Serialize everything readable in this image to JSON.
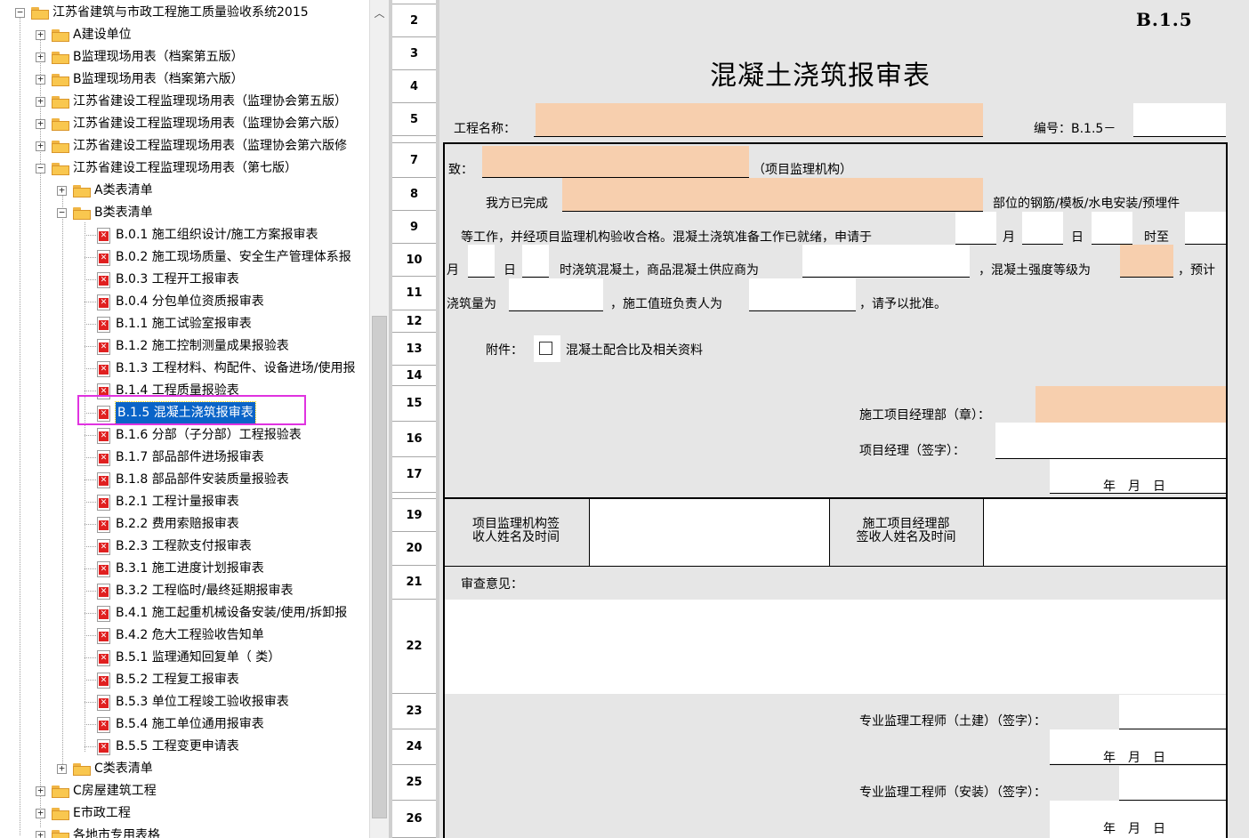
{
  "tree": {
    "root": "江苏省建筑与市政工程施工质量验收系统2015",
    "nodes": [
      "A建设单位",
      "B监理现场用表（档案第五版）",
      "B监理现场用表（档案第六版）",
      "江苏省建设工程监理现场用表（监理协会第五版）",
      "江苏省建设工程监理现场用表（监理协会第六版）",
      "江苏省建设工程监理现场用表（监理协会第六版修",
      "江苏省建设工程监理现场用表（第七版）",
      "A类表清单",
      "B类表清单",
      "B.0.1 施工组织设计/施工方案报审表",
      "B.0.2 施工现场质量、安全生产管理体系报",
      "B.0.3 工程开工报审表",
      "B.0.4 分包单位资质报审表",
      "B.1.1 施工试验室报审表",
      "B.1.2 施工控制测量成果报验表",
      "B.1.3 工程材料、构配件、设备进场/使用报",
      "B.1.4 工程质量报验表",
      "B.1.5 混凝土浇筑报审表",
      "B.1.6 分部（子分部）工程报验表",
      "B.1.7 部品部件进场报审表",
      "B.1.8 部品部件安装质量报验表",
      "B.2.1 工程计量报审表",
      "B.2.2 费用索赔报审表",
      "B.2.3 工程款支付报审表",
      "B.3.1 施工进度计划报审表",
      "B.3.2 工程临时/最终延期报审表",
      "B.4.1 施工起重机械设备安装/使用/拆卸报",
      "B.4.2 危大工程验收告知单",
      "B.5.1 监理通知回复单（ 类）",
      "B.5.2 工程复工报审表",
      "B.5.3 单位工程竣工验收报审表",
      "B.5.4 施工单位通用报审表",
      "B.5.5 工程变更申请表",
      "C类表清单",
      "C房屋建筑工程",
      "E市政工程",
      "各地市专用表格"
    ]
  },
  "rows": [
    "2",
    "3",
    "4",
    "5",
    "",
    "7",
    "8",
    "9",
    "10",
    "11",
    "12",
    "13",
    "14",
    "15",
    "16",
    "17",
    "",
    "19",
    "20",
    "21",
    "22",
    "23",
    "24",
    "25",
    "26"
  ],
  "form": {
    "code": "B.1.5",
    "title": "混凝土浇筑报审表",
    "project_name_label": "工程名称：",
    "number_label": "编号：B.1.5－",
    "to_label": "致：",
    "to_suffix": "（项目监理机构）",
    "completed_label": "我方已完成",
    "completed_suffix": "部位的钢筋/模板/水电安装/预埋件",
    "line3_text": "等工作，并经项目监理机构验收合格。混凝土浇筑准备工作已就绪，申请于",
    "month": "月",
    "day": "日",
    "hour_to": "时至",
    "month2": "月",
    "day2": "日",
    "line4_text": "时浇筑混凝土，商品混凝土供应商为",
    "strength_label": "，混凝土强度等级为",
    "estimate_label": "，预计",
    "volume_label": "浇筑量为",
    "foreman_label": "，施工值班负责人为",
    "approve_label": "，请予以批准。",
    "attach_label": "附件：",
    "attach_item": "混凝土配合比及相关资料",
    "dept_label": "施工项目经理部（章）：",
    "manager_label": "项目经理（签字）：",
    "date_ymd": "年　月　日",
    "recv1_line1": "项目监理机构签",
    "recv1_line2": "收人姓名及时间",
    "recv2_line1": "施工项目经理部",
    "recv2_line2": "签收人姓名及时间",
    "review_label": "审查意见：",
    "engineer_civil_label": "专业监理工程师（土建）（签字）：",
    "engineer_install_label": "专业监理工程师（安装）（签字）："
  },
  "colors": {
    "peach": "#f7cfae",
    "sheet_gray": "#e6e6e6",
    "selection": "#0a64c8",
    "highlight": "#e033e0"
  },
  "scroll_up_glyph": "︿"
}
